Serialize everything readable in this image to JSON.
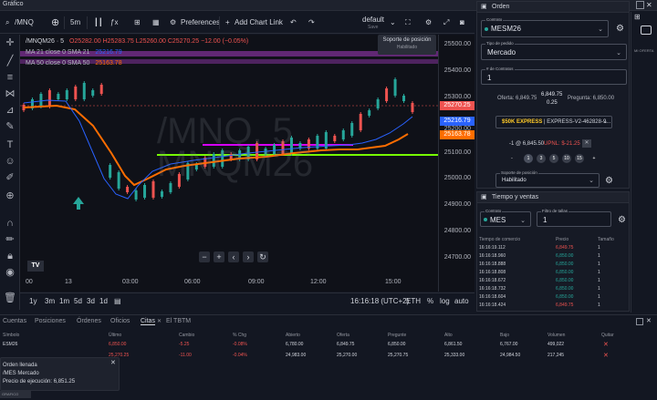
{
  "app": {
    "title": "Gráfico"
  },
  "toolbar": {
    "symbol": "/MNQ",
    "interval": "5m",
    "preferences_label": "Preferences",
    "add_chart_link_label": "Add Chart Link",
    "layout_name": "default",
    "layout_status": "Save"
  },
  "legend": {
    "symbol": "/MNQM26 · 5",
    "open": "O25282.00",
    "high": "H25283.75",
    "low": "L25260.00",
    "close": "C25270.25",
    "change": "−12.00 (−0.05%)",
    "ma21_label": "MA 21 close 0 SMA 21",
    "ma21_value": "25216.79",
    "ma50_label": "MA 50 close 0 SMA 50",
    "ma50_value": "25163.78"
  },
  "watermark": {
    "line1": "/MNQ, 5",
    "line2": "MNQM26"
  },
  "tooltip": {
    "title": "Soporte de posición",
    "sub": "Habilitado"
  },
  "price_axis": {
    "ticks": [
      "25500.00",
      "25400.00",
      "25300.00",
      "25200.00",
      "25100.00",
      "25000.00",
      "24900.00",
      "24800.00",
      "24700.00"
    ],
    "last_price": "25270.25",
    "ma21_price": "25216.79",
    "ma50_price": "25163.78"
  },
  "time_axis": {
    "ticks": [
      "00",
      "13",
      "03:00",
      "06:00",
      "09:00",
      "12:00",
      "15:00"
    ]
  },
  "chart_bottom": {
    "ranges": [
      "1y",
      "3m",
      "1m",
      "5d",
      "3d",
      "1d"
    ],
    "clock": "16:16:18 (UTC+2)",
    "session": "ETH",
    "percent": "%",
    "log": "log",
    "auto": "auto"
  },
  "order_panel": {
    "title": "Orden",
    "contract_label": "Contrato",
    "contract": "MESM26",
    "order_type_label": "Tipo de pedido",
    "order_type": "Mercado",
    "qty_label": "# de Contratos",
    "qty": "1",
    "bid_label": "Oferta: 6,849.75",
    "last": "6,849.75",
    "spread": "0.25",
    "ask_label": "Pregunta: 6,850.00",
    "account": "$50K EXPRESS",
    "account_id": "EXPRESS-V2-462828-9...",
    "position": "-1 @ 6,845.50",
    "upnl": "UPNL: $-21.25",
    "quick_minus": "-",
    "quick_plus": "+",
    "quick": [
      "1",
      "3",
      "5",
      "10",
      "15"
    ],
    "support_label": "Soporte de posición",
    "support": "Habilitado"
  },
  "time_sales": {
    "title": "Tiempo y ventas",
    "contract_label": "Contrato",
    "contract": "MES",
    "filter_label": "Filtro de tallas",
    "filter": "1",
    "headers": [
      "Tiempo de comercio",
      "Precio",
      "Tamaño"
    ],
    "rows": [
      [
        "16:16:19.112",
        "6,849.75",
        "1"
      ],
      [
        "16:16:18.960",
        "6,850.00",
        "1"
      ],
      [
        "16:16:18.888",
        "6,850.00",
        "1"
      ],
      [
        "16:16:18.808",
        "6,850.00",
        "1"
      ],
      [
        "16:16:18.672",
        "6,850.00",
        "1"
      ],
      [
        "16:16:18.732",
        "6,850.00",
        "1"
      ],
      [
        "16:16:18.604",
        "6,850.00",
        "1"
      ],
      [
        "16:16:18.424",
        "6,849.75",
        "1"
      ]
    ]
  },
  "right_strip": {
    "label": "MI OFERTA"
  },
  "bottom": {
    "tabs": [
      "Cuentas",
      "Posiciones",
      "Órdenes",
      "Oficios",
      "Citas",
      "El TBTM"
    ],
    "active_tab": "Citas",
    "headers": [
      "Símbolo",
      "Último",
      "Cambio",
      "% Chg",
      "Abierto",
      "Oferta",
      "Pregunte",
      "Alto",
      "Bajo",
      "Volumen",
      "Quitar"
    ],
    "rows": [
      [
        "ESM26",
        "6,850.00",
        "-5.25",
        "-0.08%",
        "6,780.00",
        "6,849.75",
        "6,850.00",
        "6,861.50",
        "6,767.00",
        "499,022"
      ],
      [
        "",
        "25,270.25",
        "-11.00",
        "-0.04%",
        "24,983.00",
        "25,270.00",
        "25,270.75",
        "25,333.00",
        "24,984.50",
        "217,245"
      ]
    ]
  },
  "toast": {
    "title": "Orden llenada",
    "line1": "/MES Mercado",
    "line2": "Precio de ejecución: 6,851.25"
  },
  "chip": "GRAFICO SIMBOLO"
}
